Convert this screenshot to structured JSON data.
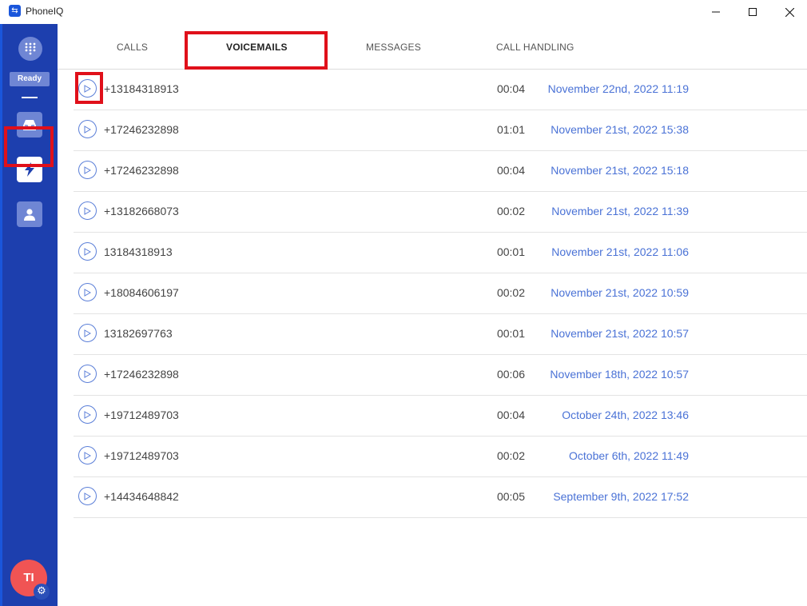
{
  "window": {
    "title": "PhoneIQ",
    "app_icon_glyph": "⇆",
    "controls": [
      "minimize",
      "maximize",
      "close"
    ]
  },
  "sidebar": {
    "status_label": "Ready",
    "avatar_initials": "TI",
    "nav": [
      {
        "name": "inbox",
        "icon": "inbox-icon"
      },
      {
        "name": "activity",
        "icon": "lightning-bolt-icon",
        "active": true
      },
      {
        "name": "contacts",
        "icon": "user-icon"
      }
    ],
    "colors": {
      "background": "#1d3fae",
      "button": "#6f86d4",
      "avatar": "#f05454"
    }
  },
  "tabs": [
    {
      "label": "CALLS",
      "active": false
    },
    {
      "label": "VOICEMAILS",
      "active": true
    },
    {
      "label": "MESSAGES",
      "active": false
    },
    {
      "label": "CALL HANDLING",
      "active": false
    }
  ],
  "voicemails": [
    {
      "number": "+13184318913",
      "duration": "00:04",
      "datetime": "November 22nd, 2022 11:19"
    },
    {
      "number": "+17246232898",
      "duration": "01:01",
      "datetime": "November 21st, 2022 15:38"
    },
    {
      "number": "+17246232898",
      "duration": "00:04",
      "datetime": "November 21st, 2022 15:18"
    },
    {
      "number": "+13182668073",
      "duration": "00:02",
      "datetime": "November 21st, 2022 11:39"
    },
    {
      "number": "13184318913",
      "duration": "00:01",
      "datetime": "November 21st, 2022 11:06"
    },
    {
      "number": "+18084606197",
      "duration": "00:02",
      "datetime": "November 21st, 2022 10:59"
    },
    {
      "number": "13182697763",
      "duration": "00:01",
      "datetime": "November 21st, 2022 10:57"
    },
    {
      "number": "+17246232898",
      "duration": "00:06",
      "datetime": "November 18th, 2022 10:57"
    },
    {
      "number": "+19712489703",
      "duration": "00:04",
      "datetime": "October 24th, 2022 13:46"
    },
    {
      "number": "+19712489703",
      "duration": "00:02",
      "datetime": "October 6th, 2022 11:49"
    },
    {
      "number": "+14434648842",
      "duration": "00:05",
      "datetime": "September 9th, 2022 17:52"
    }
  ],
  "accent_color": "#4a72d6",
  "highlight_color": "#e0101a"
}
